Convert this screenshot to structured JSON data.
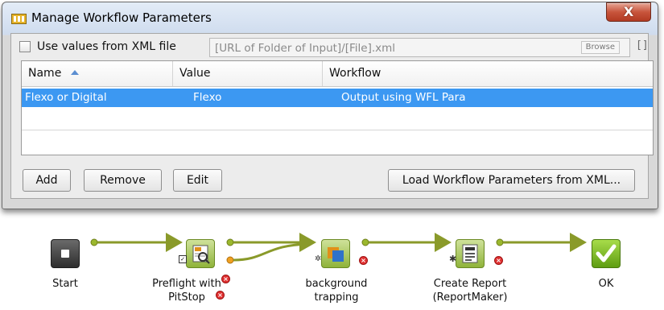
{
  "dialog": {
    "title": "Manage Workflow Parameters",
    "close_label": "X",
    "use_xml": {
      "label": "Use values from XML file",
      "checked": false
    },
    "xml_path": "[URL of Folder of Input]/[File].xml",
    "browse_label": "Browse",
    "bracket_label": "[]",
    "table": {
      "columns": [
        "Name",
        "Value",
        "Workflow"
      ],
      "rows": [
        {
          "name": "Flexo or Digital",
          "value": "Flexo",
          "workflow": "Output using WFL Para",
          "selected": true
        }
      ]
    },
    "buttons": {
      "add": "Add",
      "remove": "Remove",
      "edit": "Edit",
      "load": "Load Workflow Parameters from XML..."
    }
  },
  "workflow": {
    "nodes": [
      {
        "id": "start",
        "label": "Start",
        "icon": "stop-square-icon"
      },
      {
        "id": "preflight",
        "label_line1": "Preflight with",
        "label_line2": "PitStop",
        "icon": "preflight-icon"
      },
      {
        "id": "trapping",
        "label_line1": "background",
        "label_line2": "trapping",
        "icon": "trapping-icon"
      },
      {
        "id": "report",
        "label_line1": "Create Report",
        "label_line2": "(ReportMaker)",
        "icon": "report-icon"
      },
      {
        "id": "ok",
        "label": "OK",
        "icon": "checkmark-icon"
      }
    ]
  },
  "colors": {
    "selection": "#3c98f2",
    "connector": "#8a9a2a",
    "error": "#e03030",
    "ok_green": "#7cbf1f",
    "close_red": "#c8553c"
  }
}
